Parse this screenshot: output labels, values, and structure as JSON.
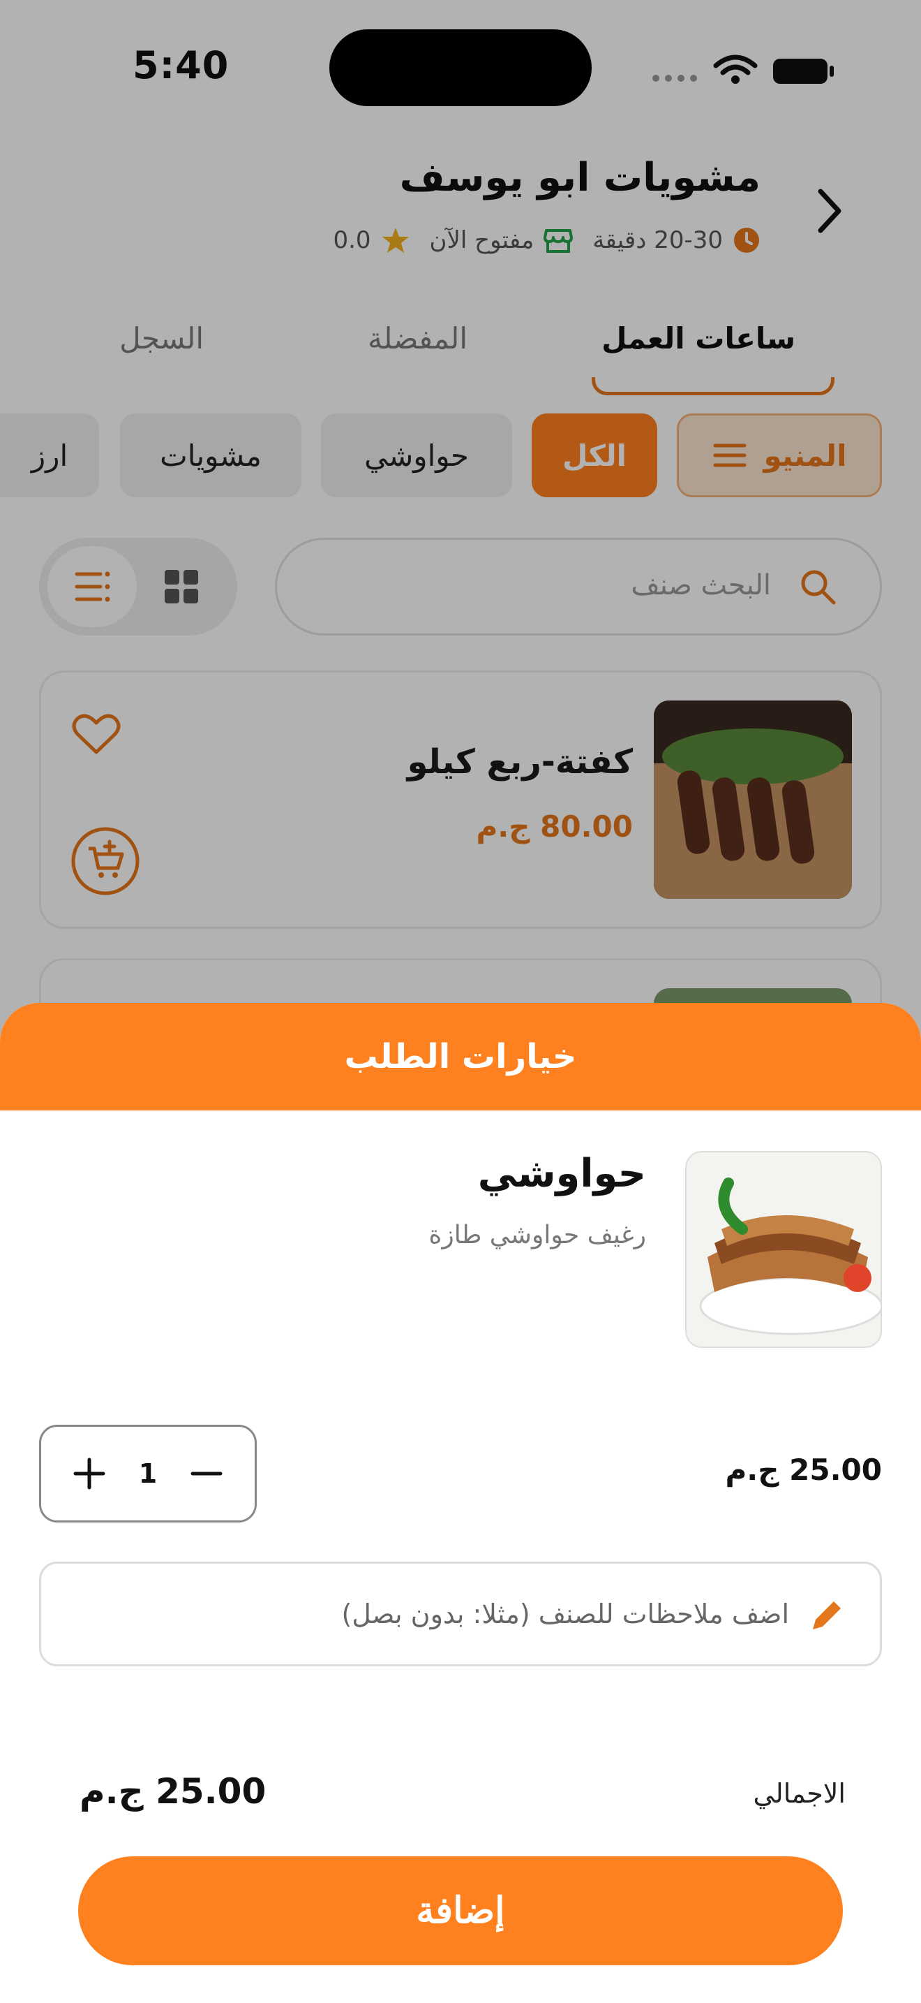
{
  "status_bar": {
    "time": "5:40"
  },
  "restaurant": {
    "name": "مشويات ابو يوسف",
    "delivery_time": "20-30 دقيقة",
    "open_status": "مفتوح الآن",
    "rating": "0.0"
  },
  "tabs": [
    {
      "label": "ساعات العمل",
      "active": true
    },
    {
      "label": "المفضلة",
      "active": false
    },
    {
      "label": "السجل",
      "active": false
    }
  ],
  "categories": {
    "menu_label": "المنيو",
    "items": [
      "الكل",
      "حواوشي",
      "مشويات",
      "ارز"
    ]
  },
  "search": {
    "placeholder": "البحث صنف"
  },
  "product": {
    "name": "كفتة-ربع كيلو",
    "price": "80.00 ج.م"
  },
  "sheet": {
    "title": "خيارات الطلب",
    "item_name": "حواوشي",
    "item_desc": "رغيف حواوشي طازة",
    "quantity": "1",
    "unit_price": "25.00 ج.م",
    "notes_placeholder": "اضف ملاحظات للصنف (مثلا: بدون بصل)",
    "total_label": "الاجمالي",
    "total_value": "25.00 ج.م",
    "add_button": "إضافة"
  },
  "colors": {
    "accent": "#ff801f",
    "accent_dark": "#e4761b",
    "open_green": "#22a245",
    "star": "#f2b01e"
  },
  "icons": [
    "back-chevron-icon",
    "clock-icon",
    "store-icon",
    "star-icon",
    "menu-icon",
    "search-icon",
    "list-icon",
    "grid-icon",
    "heart-icon",
    "add-to-cart-icon",
    "plus-icon",
    "minus-icon",
    "pencil-icon"
  ]
}
